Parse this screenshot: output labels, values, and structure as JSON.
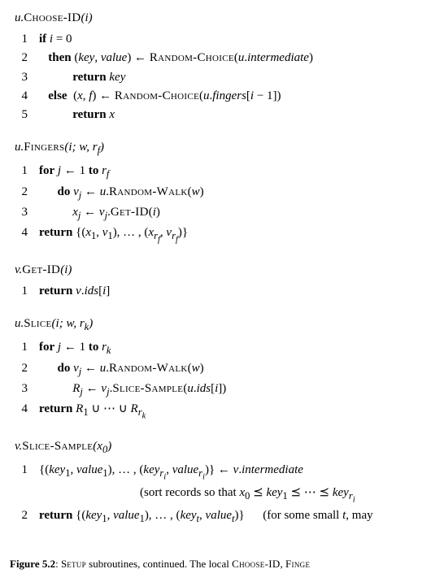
{
  "algos": {
    "chooseId": {
      "sig_obj": "u",
      "sig_name": "Choose-ID",
      "sig_args": "(i)",
      "lines": [
        "<span class='kw'>if</span> <span class='it'>i</span> = 0",
        "   <span class='kw'>then</span> (<span class='it'>key</span>, <span class='it'>value</span>) ← <span class='sc'>Random-Choice</span>(<span class='it'>u</span>.<span class='it'>intermediate</span>)",
        "           <span class='kw'>return</span> <span class='it'>key</span>",
        "   <span class='kw'>else</span>  (<span class='it'>x</span>, <span class='it'>f</span>) ← <span class='sc'>Random-Choice</span>(<span class='it'>u</span>.<span class='it'>fingers</span>[<span class='it'>i</span> − 1])",
        "           <span class='kw'>return</span> <span class='it'>x</span>"
      ]
    },
    "fingers": {
      "sig_obj": "u",
      "sig_name": "Fingers",
      "sig_args": "(i; w, r<sub>f</sub>)",
      "lines": [
        "<span class='kw'>for</span> <span class='it'>j</span> ← 1 <span class='kw'>to</span> <span class='it'>r<sub>f</sub></span>",
        "      <span class='kw'>do</span> <span class='it'>v<sub>j</sub></span> ← <span class='it'>u</span>.<span class='sc'>Random-Walk</span>(<span class='it'>w</span>)",
        "           <span class='it'>x<sub>j</sub></span> ← <span class='it'>v<sub>j</sub></span>.<span class='sc'>Get-ID</span>(<span class='it'>i</span>)",
        "<span class='kw'>return</span> <span class='sym'>{</span>(<span class='it'>x</span><sub>1</sub>, <span class='it'>v</span><sub>1</sub>), … , (<span class='it'>x<sub>r<sub>f</sub></sub></span>, <span class='it'>v<sub>r<sub>f</sub></sub></span>)<span class='sym'>}</span>"
      ]
    },
    "getId": {
      "sig_obj": "v",
      "sig_name": "Get-ID",
      "sig_args": "(i)",
      "lines": [
        "<span class='kw'>return</span> <span class='it'>v</span>.<span class='it'>ids</span>[<span class='it'>i</span>]"
      ]
    },
    "slice": {
      "sig_obj": "u",
      "sig_name": "Slice",
      "sig_args": "(i; w, r<sub>k</sub>)",
      "lines": [
        "<span class='kw'>for</span> <span class='it'>j</span> ← 1 <span class='kw'>to</span> <span class='it'>r<sub>k</sub></span>",
        "      <span class='kw'>do</span> <span class='it'>v<sub>j</sub></span> ← <span class='it'>u</span>.<span class='sc'>Random-Walk</span>(<span class='it'>w</span>)",
        "           <span class='it'>R<sub>j</sub></span> ← <span class='it'>v<sub>j</sub></span>.<span class='sc'>Slice-Sample</span>(<span class='it'>u</span>.<span class='it'>ids</span>[<span class='it'>i</span>])",
        "<span class='kw'>return</span> <span class='it'>R</span><sub>1</sub> ∪ ⋯ ∪ <span class='it'>R<sub>r<sub>k</sub></sub></span>"
      ]
    },
    "sliceSample": {
      "sig_obj": "v",
      "sig_name": "Slice-Sample",
      "sig_args": "(x<sub>0</sub>)",
      "lines": [
        "<span class='sym'>{</span>(<span class='it'>key</span><sub>1</sub>, <span class='it'>value</span><sub>1</sub>), … , (<span class='it'>key<sub>r<sub>i</sub></sub></span>, <span class='it'>value<sub>r<sub>i</sub></sub></span>)<span class='sym'>}</span> ← <span class='it'>v</span>.<span class='it'>intermediate</span>",
        "<span class='kw'>return</span> <span class='sym'>{</span>(<span class='it'>key</span><sub>1</sub>, <span class='it'>value</span><sub>1</sub>), … , (<span class='it'>key<sub>t</sub></span>, <span class='it'>value<sub>t</sub></span>)<span class='sym'>}</span>      (for some small <span class='it'>t</span>, may"
      ],
      "note_after_1": "(sort records so that <span class='it'>x</span><sub>0</sub> ⪯ <span class='it'>key</span><sub>1</sub> ⪯ ⋯ ⪯ <span class='it'>key<sub>r<sub>i</sub></sub></span>"
    }
  },
  "caption": {
    "label": "Figure 5.2",
    "text": ": S<span class='sc'>etup</span> subroutines, continued. The local <span class='sc'>Choose-ID</span>, <span class='sc'>Finge</span>"
  }
}
